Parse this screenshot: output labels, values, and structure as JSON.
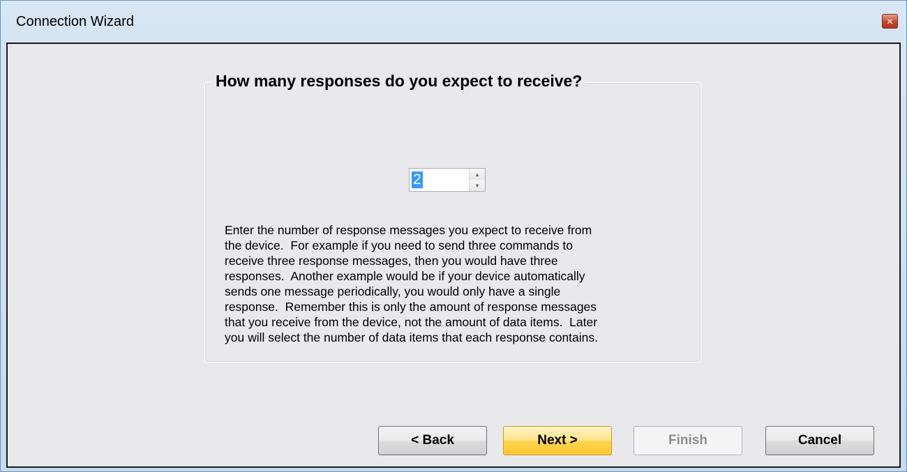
{
  "window": {
    "title": "Connection Wizard",
    "close_symbol": "✕"
  },
  "group": {
    "title": "How many responses do you expect to receive?"
  },
  "spinner": {
    "value": "2",
    "up_symbol": "▲",
    "down_symbol": "▼"
  },
  "description": "Enter the number of response messages you expect to receive from\nthe device.  For example if you need to send three commands to\nreceive three response messages, then you would have three\nresponses.  Another example would be if your device automatically\nsends one message periodically, you would only have a single\nresponse.  Remember this is only the amount of response messages\nthat you receive from the device, not the amount of data items.  Later\nyou will select the number of data items that each response contains.",
  "buttons": {
    "back": "< Back",
    "next": "Next >",
    "finish": "Finish",
    "cancel": "Cancel"
  },
  "button_states": {
    "finish_enabled": false,
    "default_button": "next"
  },
  "colors": {
    "selection": "#3399ff",
    "default_button": "#ffd34d",
    "close_button": "#c8452e"
  },
  "icons": {
    "close": "close-icon",
    "spin_up": "spin-up-arrow-icon",
    "spin_down": "spin-down-arrow-icon"
  }
}
